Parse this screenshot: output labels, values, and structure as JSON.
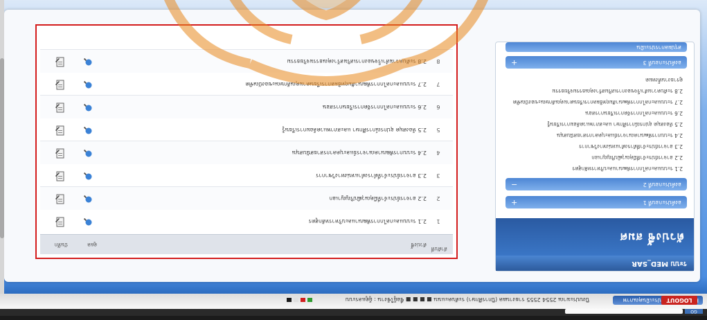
{
  "browser": {
    "go_label": "GO"
  },
  "menubar": {
    "home_label": "Home > ระบบประเมินคุณภาพ",
    "info_text": "ปีงบประมาณ 2554 2555 รายงานผล (ปีการศึกษา) ระดับคะแนน ■ ■ ■ ■  ชื่อผู้ใช้งาน : ผู้ดูแลระบบ",
    "logout_label": "LOGOUT",
    "status_colors": [
      "#2e9b2e",
      "#d11f1f",
      "#e0e0e0",
      "#1a1a1a"
    ]
  },
  "left_panel": {
    "system_label": "ระบบ MED_SAR",
    "title": "ตัวบ่งชี้ สมศ",
    "accordion": [
      {
        "label": "องค์ประกอบที่ 1",
        "sign": "+"
      },
      {
        "label": "องค์ประกอบที่ 2",
        "sign": "−"
      },
      {
        "label": "องค์ประกอบที่ 3",
        "sign": "+"
      },
      {
        "label": "สรุปผลการประเมิน",
        "sign": ""
      }
    ],
    "items": [
      "2.1 ระบบและกลไกการพัฒนาและบริหารหลักสูตร",
      "2.2 อาจารย์ประจำที่มีคุณวุฒิปริญญาเอก",
      "2.3 อาจารย์ประจำที่ดำรงตำแหน่งทางวิชาการ",
      "2.4 ระบบการพัฒนาคณาจารย์และบุคลากรสายสนับสนุน",
      "2.5 ห้องสมุด อุปกรณ์การศึกษา และสภาพแวดล้อมการเรียนรู้",
      "2.6 ระบบและกลไกการจัดการเรียนการสอน",
      "2.7 ระบบและกลไกการพัฒนาสัมฤทธิผลการเรียนตามคุณลักษณะของบัณฑิต",
      "2.8 ระดับความสำเร็จของการเสริมสร้างคุณธรรมจริยธรรม",
      "ดูรายงานทั้งหมด"
    ]
  },
  "table": {
    "headers": {
      "no": "ลำดับที่",
      "topic": "ตัวบ่งชี้",
      "view": "ดูผล",
      "save": "บันทึก"
    },
    "rows": [
      {
        "no": "1",
        "topic": "2.1 ระบบและกลไกการพัฒนาและบริหารหลักสูตร"
      },
      {
        "no": "2",
        "topic": "2.2 อาจารย์ประจำที่มีคุณวุฒิปริญญาเอก"
      },
      {
        "no": "3",
        "topic": "2.3 อาจารย์ประจำที่ดำรงตำแหน่งทางวิชาการ"
      },
      {
        "no": "4",
        "topic": "2.4 ระบบการพัฒนาคณาจารย์และบุคลากรสายสนับสนุน"
      },
      {
        "no": "5",
        "topic": "2.5 ห้องสมุด อุปกรณ์การศึกษา และสภาพแวดล้อมการเรียนรู้"
      },
      {
        "no": "6",
        "topic": "2.6 ระบบและกลไกการจัดการเรียนการสอน"
      },
      {
        "no": "7",
        "topic": "2.7 ระบบและกลไกการพัฒนาสัมฤทธิผลการเรียนตามคุณลักษณะของบัณฑิต"
      },
      {
        "no": "8",
        "topic": "2.8 ระดับความสำเร็จของการเสริมสร้างคุณธรรมจริยธรรม"
      }
    ]
  },
  "colors": {
    "accent_red": "#d31b1b",
    "header_blue": "#2c5a9c",
    "watermark": "#e8891f"
  }
}
